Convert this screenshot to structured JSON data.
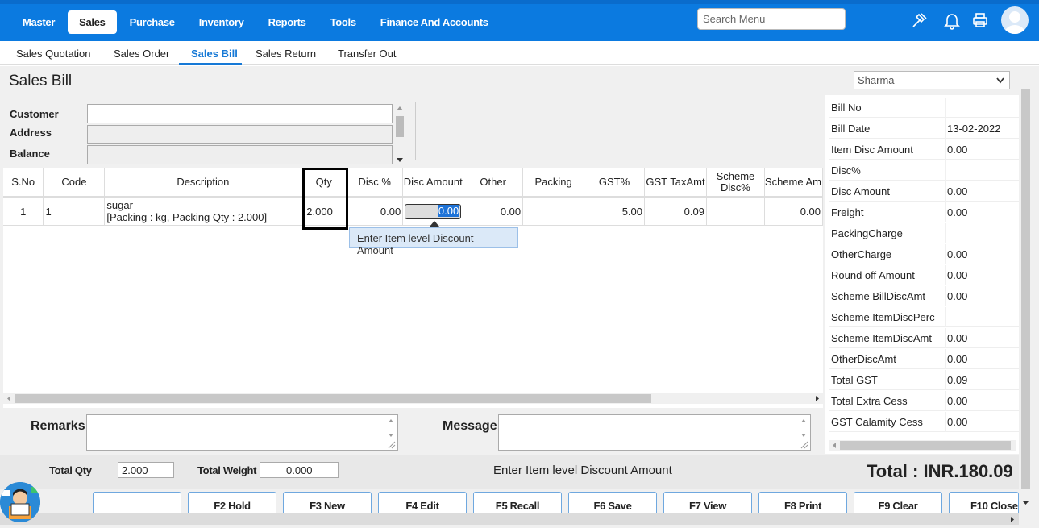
{
  "topnav": {
    "items": [
      "Master",
      "Sales",
      "Purchase",
      "Inventory",
      "Reports",
      "Tools",
      "Finance And Accounts"
    ],
    "active": "Sales",
    "search_placeholder": "Search Menu"
  },
  "subnav": {
    "items": [
      "Sales Quotation",
      "Sales Order",
      "Sales Bill",
      "Sales Return",
      "Transfer Out"
    ],
    "active": "Sales Bill"
  },
  "page": {
    "title": "Sales Bill",
    "user_select": "Sharma"
  },
  "form": {
    "customer_label": "Customer",
    "address_label": "Address",
    "balance_label": "Balance"
  },
  "grid": {
    "headers": [
      "S.No",
      "Code",
      "Description",
      "Qty",
      "Disc %",
      "Disc Amount",
      "Other",
      "Packing",
      "GST%",
      "GST TaxAmt",
      "Scheme Disc%",
      "Scheme Am"
    ],
    "rows": [
      {
        "sno": "1",
        "code": "1",
        "desc_line1": "sugar",
        "desc_line2": "[Packing : kg, Packing Qty : 2.000]",
        "qty": "2.000",
        "disc_pct": "0.00",
        "disc_amount": "0.00",
        "other": "0.00",
        "packing": "",
        "gst_pct": "5.00",
        "gst_taxamt": "0.09",
        "scheme_disc_pct": "",
        "scheme_amt": "0.00"
      }
    ],
    "tooltip": "Enter Item level Discount Amount"
  },
  "remarks": {
    "remarks_label": "Remarks",
    "message_label": "Message"
  },
  "summary": [
    {
      "label": "Bill No",
      "value": ""
    },
    {
      "label": "Bill Date",
      "value": "13-02-2022"
    },
    {
      "label": "Item Disc Amount",
      "value": "0.00"
    },
    {
      "label": "Disc%",
      "value": ""
    },
    {
      "label": "Disc Amount",
      "value": "0.00"
    },
    {
      "label": "Freight",
      "value": "0.00"
    },
    {
      "label": "PackingCharge",
      "value": ""
    },
    {
      "label": "OtherCharge",
      "value": "0.00"
    },
    {
      "label": "Round off Amount",
      "value": "0.00"
    },
    {
      "label": "Scheme BillDiscAmt",
      "value": "0.00"
    },
    {
      "label": "Scheme ItemDiscPerc",
      "value": ""
    },
    {
      "label": "Scheme ItemDiscAmt",
      "value": "0.00"
    },
    {
      "label": "OtherDiscAmt",
      "value": "0.00"
    },
    {
      "label": "Total GST",
      "value": "0.09"
    },
    {
      "label": "Total Extra Cess",
      "value": "0.00"
    },
    {
      "label": "GST Calamity Cess",
      "value": "0.00"
    }
  ],
  "totals": {
    "total_qty_label": "Total Qty",
    "total_qty": "2.000",
    "total_weight_label": "Total Weight",
    "total_weight": "0.000",
    "hint": "Enter Item level Discount Amount",
    "grand_total": "Total : INR.180.09"
  },
  "buttons": [
    "",
    "F2 Hold",
    "F3 New",
    "F4 Edit",
    "F5 Recall",
    "F6 Save",
    "F7 View",
    "F8 Print",
    "F9 Clear",
    "F10 Close"
  ],
  "colors": {
    "brand": "#0b7ae0",
    "active_sub": "#1679d6",
    "tooltip_bg": "#dbe9f8"
  }
}
